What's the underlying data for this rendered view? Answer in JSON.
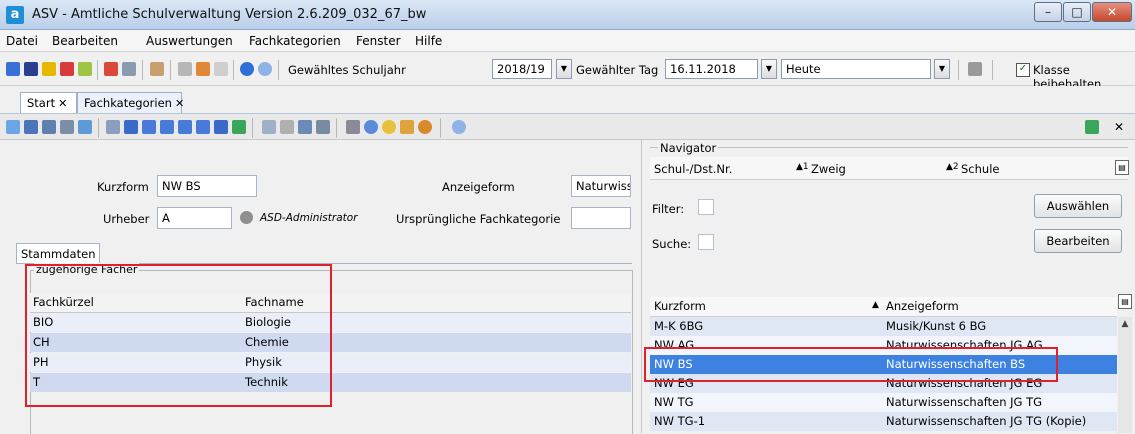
{
  "window": {
    "title": "ASV - Amtliche Schulverwaltung Version 2.6.209_032_67_bw",
    "app_icon": "a"
  },
  "menu": [
    "Datei",
    "Bearbeiten",
    "Auswertungen",
    "Fachkategorien",
    "Fenster",
    "Hilfe"
  ],
  "toolbar": {
    "schuljahr_label": "Gewähltes Schuljahr",
    "schuljahr_value": "2018/19",
    "tag_label": "Gewählter Tag",
    "tag_value": "16.11.2018",
    "heute_value": "Heute",
    "klasse_label": "Klasse beibehalten",
    "klasse_checked": "✓"
  },
  "tabs": [
    {
      "label": "Start",
      "close": "✕"
    },
    {
      "label": "Fachkategorien",
      "close": "✕"
    }
  ],
  "form": {
    "kurzform_label": "Kurzform",
    "kurzform_value": "NW BS",
    "anzeigeform_label": "Anzeigeform",
    "anzeigeform_value": "Naturwiss",
    "urheber_label": "Urheber",
    "urheber_value": "A",
    "urheber_name": "ASD-Administrator",
    "urspr_label": "Ursprüngliche Fachkategorie",
    "urspr_value": ""
  },
  "stammdaten_tab": "Stammdaten",
  "faecher": {
    "group_title": "zugehörige Fächer",
    "headers": [
      "Fachkürzel",
      "Fachname"
    ],
    "rows": [
      {
        "kuerzel": "BIO",
        "name": "Biologie"
      },
      {
        "kuerzel": "CH",
        "name": "Chemie"
      },
      {
        "kuerzel": "PH",
        "name": "Physik"
      },
      {
        "kuerzel": "T",
        "name": "Technik"
      }
    ]
  },
  "navigator": {
    "title": "Navigator",
    "col_schul": "Schul-/Dst.Nr.",
    "col_zweig": "Zweig",
    "col_zweig_sort": "▲1",
    "col_schule": "Schule",
    "col_schule_sort": "▲2",
    "filter_label": "Filter:",
    "suche_label": "Suche:",
    "auswaehlen_button": "Auswählen",
    "bearbeiten_button": "Bearbeiten",
    "list_headers": [
      "Kurzform",
      "Anzeigeform"
    ],
    "list_sort": "▲",
    "rows": [
      {
        "kurz": "M-K 6BG",
        "anzeige": "Musik/Kunst 6 BG"
      },
      {
        "kurz": "NW AG",
        "anzeige": "Naturwissenschaften JG AG"
      },
      {
        "kurz": "NW BS",
        "anzeige": "Naturwissenschaften BS"
      },
      {
        "kurz": "NW EG",
        "anzeige": "Naturwissenschaften JG EG"
      },
      {
        "kurz": "NW TG",
        "anzeige": "Naturwissenschaften JG TG"
      },
      {
        "kurz": "NW TG-1",
        "anzeige": "Naturwissenschaften JG TG (Kopie)"
      }
    ],
    "selected_index": 2
  },
  "colors": {
    "highlight": "#e0202a",
    "selection": "#3d82e0",
    "accent": "#1f8fd6"
  }
}
